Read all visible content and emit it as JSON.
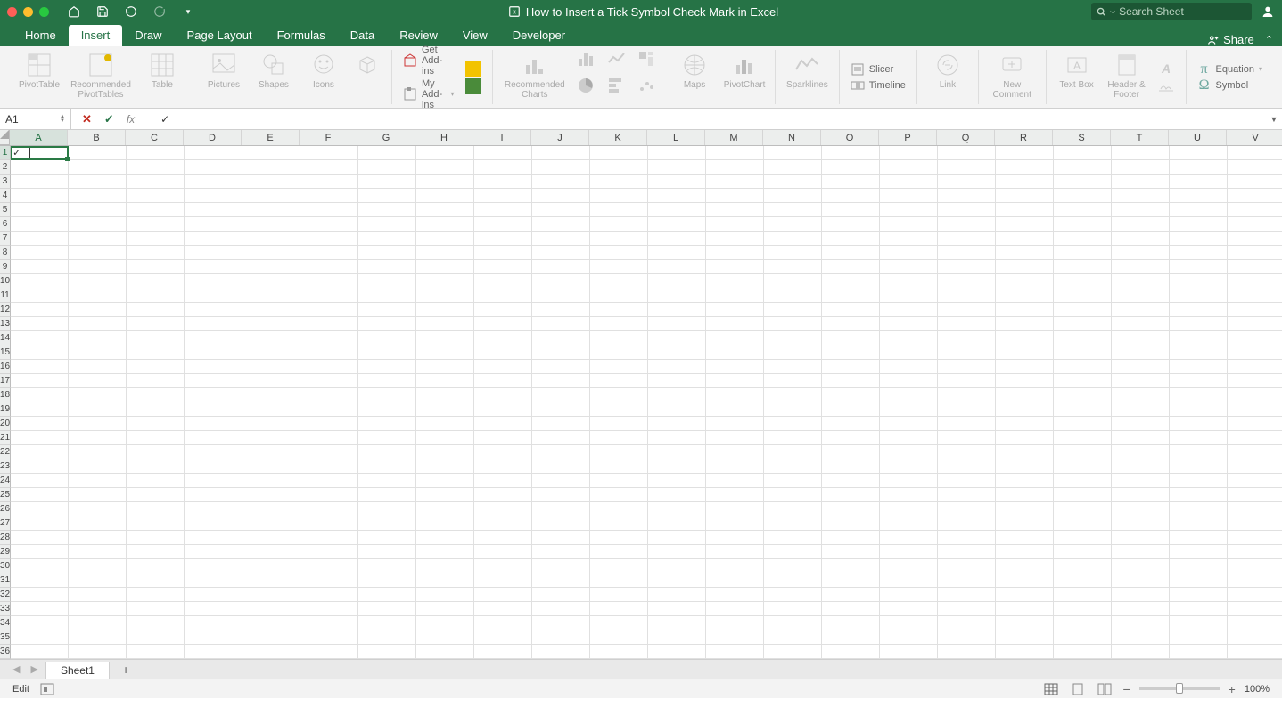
{
  "titlebar": {
    "document_title": "How to Insert a Tick Symbol Check Mark in Excel",
    "search_placeholder": "Search Sheet"
  },
  "ribbon_tabs": [
    "Home",
    "Insert",
    "Draw",
    "Page Layout",
    "Formulas",
    "Data",
    "Review",
    "View",
    "Developer"
  ],
  "active_tab_index": 1,
  "share_label": "Share",
  "ribbon": {
    "pivottable": "PivotTable",
    "recpivot": "Recommended PivotTables",
    "table": "Table",
    "pictures": "Pictures",
    "shapes": "Shapes",
    "icons": "Icons",
    "get_addins": "Get Add-ins",
    "my_addins": "My Add-ins",
    "rec_charts": "Recommended Charts",
    "maps": "Maps",
    "pivotchart": "PivotChart",
    "sparklines": "Sparklines",
    "slicer": "Slicer",
    "timeline": "Timeline",
    "link": "Link",
    "new_comment": "New Comment",
    "textbox": "Text Box",
    "headerfooter": "Header & Footer",
    "equation": "Equation",
    "symbol": "Symbol"
  },
  "formula_bar": {
    "name_box": "A1",
    "fx_label": "fx",
    "formula_value": "✓"
  },
  "columns": [
    "A",
    "B",
    "C",
    "D",
    "E",
    "F",
    "G",
    "H",
    "I",
    "J",
    "K",
    "L",
    "M",
    "N",
    "O",
    "P",
    "Q",
    "R",
    "S",
    "T",
    "U",
    "V"
  ],
  "rows": [
    1,
    2,
    3,
    4,
    5,
    6,
    7,
    8,
    9,
    10,
    11,
    12,
    13,
    14,
    15,
    16,
    17,
    18,
    19,
    20,
    21,
    22,
    23,
    24,
    25,
    26,
    27,
    28,
    29,
    30,
    31,
    32,
    33,
    34,
    35,
    36
  ],
  "cells": {
    "A1": "✓"
  },
  "selected_cell": {
    "row": 1,
    "col": "A"
  },
  "sheet_tabs": {
    "active": "Sheet1"
  },
  "status_bar": {
    "mode": "Edit",
    "zoom": "100%"
  }
}
